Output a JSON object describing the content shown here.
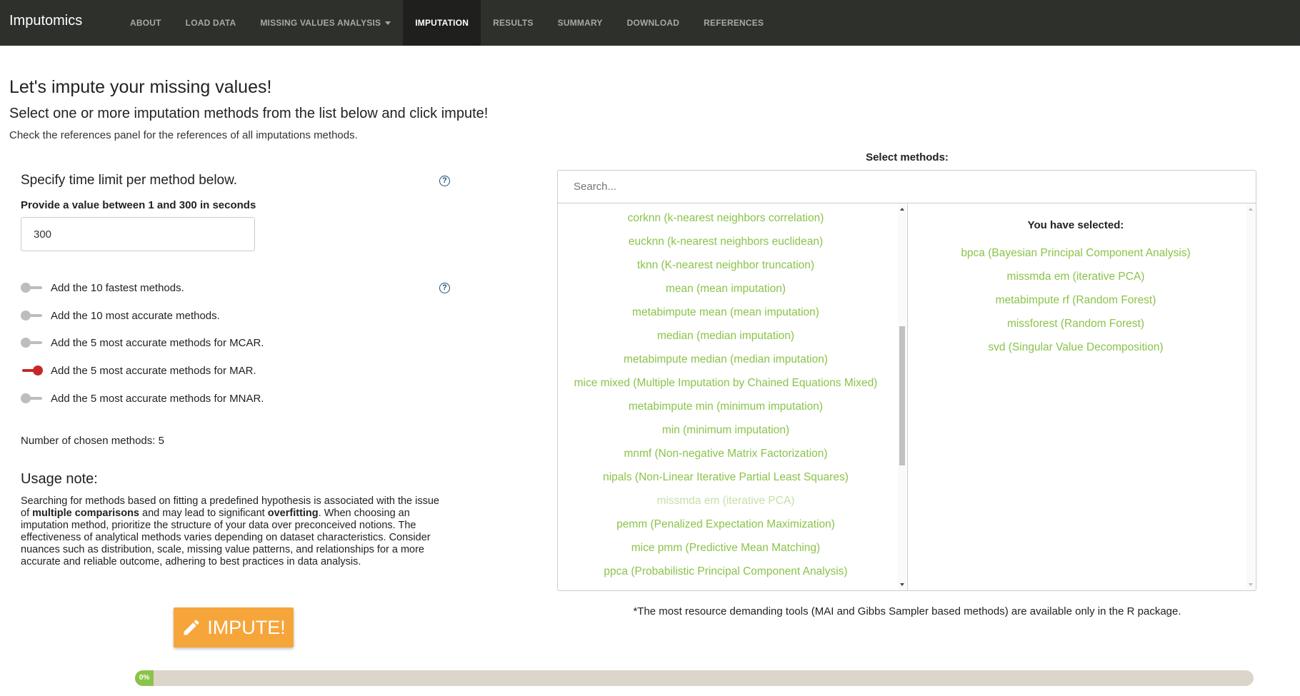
{
  "navbar": {
    "brand": "Imputomics",
    "items": [
      {
        "label": "ABOUT"
      },
      {
        "label": "LOAD DATA"
      },
      {
        "label": "MISSING VALUES ANALYSIS"
      },
      {
        "label": "IMPUTATION"
      },
      {
        "label": "RESULTS"
      },
      {
        "label": "SUMMARY"
      },
      {
        "label": "DOWNLOAD"
      },
      {
        "label": "REFERENCES"
      }
    ],
    "active": "IMPUTATION"
  },
  "header": {
    "title": "Let's impute your missing values!",
    "subtitle": "Select one or more imputation methods from the list below and click impute!",
    "note": "Check the references panel for the references of all imputations methods."
  },
  "time_limit": {
    "title": "Specify time limit per method below.",
    "label": "Provide a value between 1 and 300 in seconds",
    "value": "300"
  },
  "switches": [
    {
      "label": "Add the 10 fastest methods.",
      "on": false
    },
    {
      "label": "Add the 10 most accurate methods.",
      "on": false
    },
    {
      "label": "Add the 5 most accurate methods for MCAR.",
      "on": false
    },
    {
      "label": "Add the 5 most accurate methods for MAR.",
      "on": true
    },
    {
      "label": "Add the 5 most accurate methods for MNAR.",
      "on": false
    }
  ],
  "count_text": "Number of chosen methods: 5",
  "usage": {
    "title": "Usage note:",
    "p1": "Searching for methods based on fitting a predefined hypothesis is associated with the issue of ",
    "b1": "multiple comparisons",
    "p2": " and may lead to significant ",
    "b2": "overfitting",
    "p3": ". When choosing an imputation method, prioritize the structure of your data over preconceived notions. The effectiveness of analytical methods varies depending on dataset characteristics. Consider nuances such as distribution, scale, missing value patterns, and relationships for a more accurate and reliable outcome, adhering to best practices in data analysis."
  },
  "impute_button": {
    "label": "IMPUTE!",
    "icon": "pencil-icon"
  },
  "progress": {
    "value": 0,
    "label": "0%"
  },
  "methods": {
    "label": "Select methods:",
    "search_placeholder": "Search...",
    "available": [
      {
        "label": "corknn (k-nearest neighbors correlation)",
        "disabled": false
      },
      {
        "label": "eucknn (k-nearest neighbors euclidean)",
        "disabled": false
      },
      {
        "label": "tknn (K-nearest neighbor truncation)",
        "disabled": false
      },
      {
        "label": "mean (mean imputation)",
        "disabled": false
      },
      {
        "label": "metabimpute mean (mean imputation)",
        "disabled": false
      },
      {
        "label": "median (median imputation)",
        "disabled": false
      },
      {
        "label": "metabimpute median (median imputation)",
        "disabled": false
      },
      {
        "label": "mice mixed (Multiple Imputation by Chained Equations Mixed)",
        "disabled": false
      },
      {
        "label": "metabimpute min (minimum imputation)",
        "disabled": false
      },
      {
        "label": "min (minimum imputation)",
        "disabled": false
      },
      {
        "label": "mnmf (Non-negative Matrix Factorization)",
        "disabled": false
      },
      {
        "label": "nipals (Non-Linear Iterative Partial Least Squares)",
        "disabled": false
      },
      {
        "label": "missmda em (iterative PCA)",
        "disabled": true
      },
      {
        "label": "pemm (Penalized Expectation Maximization)",
        "disabled": false
      },
      {
        "label": "mice pmm (Predictive Mean Matching)",
        "disabled": false
      },
      {
        "label": "ppca (Probabilistic Principal Component Analysis)",
        "disabled": false
      }
    ],
    "selected_title": "You have selected:",
    "selected": [
      "bpca (Bayesian Principal Component Analysis)",
      "missmda em (iterative PCA)",
      "metabimpute rf (Random Forest)",
      "missforest (Random Forest)",
      "svd (Singular Value Decomposition)"
    ]
  },
  "footnote": "*The most resource demanding tools (MAI and Gibbs Sampler based methods) are available only in the R package."
}
